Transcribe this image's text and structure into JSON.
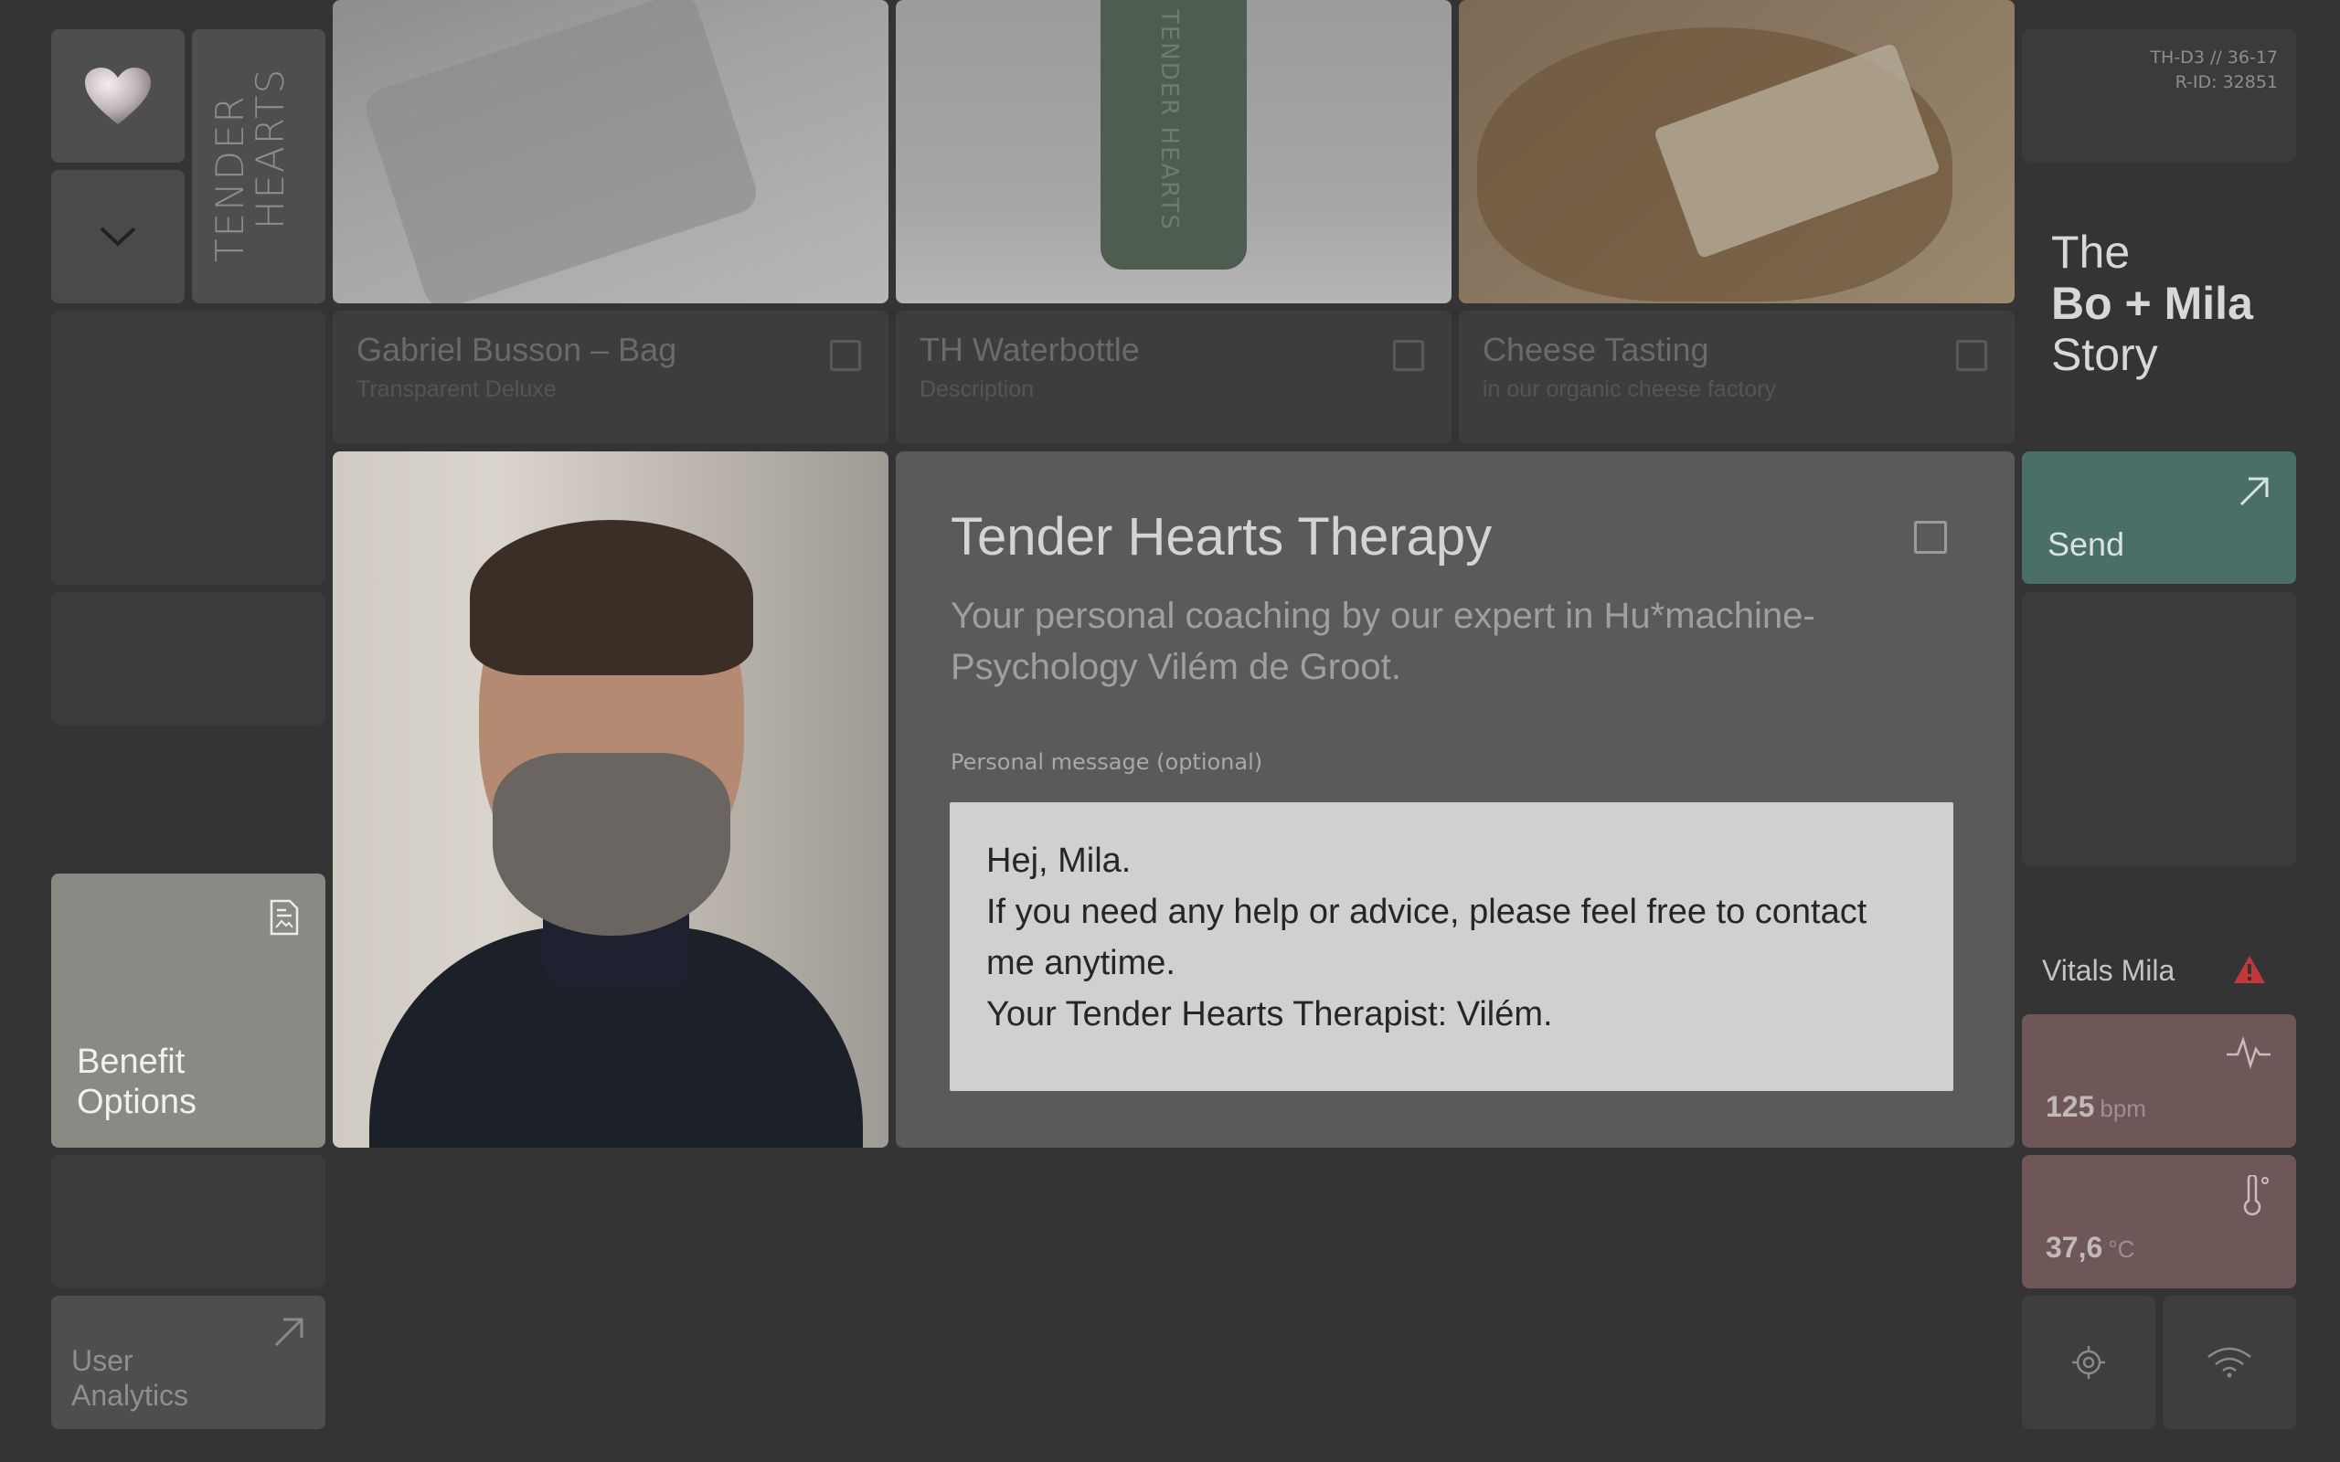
{
  "brand": {
    "logo_line1": "TENDER",
    "logo_line2": "HEARTS"
  },
  "products": [
    {
      "title": "Gabriel Busson – Bag",
      "subtitle": "Transparent Deluxe"
    },
    {
      "title": "TH Waterbottle",
      "subtitle": "Description",
      "bottle_text": "TENDER HEARTS"
    },
    {
      "title": "Cheese Tasting",
      "subtitle": "in our organic cheese factory"
    }
  ],
  "sidebar": {
    "benefit_label": "Benefit Options",
    "analytics_label": "User Analytics"
  },
  "therapy": {
    "title": "Tender Hearts Therapy",
    "description": "Your personal coaching by our expert in Hu*machine-Psychology Vilém de Groot.",
    "message_label": "Personal message (optional)",
    "message": "Hej, Mila.\nIf you need any help or advice, please feel free to contact me anytime.\nYour Tender Hearts Therapist: Vilém."
  },
  "meta": {
    "line1": "TH-D3 // 36-17",
    "line2": "R-ID: 32851"
  },
  "story": {
    "line1": "The",
    "line2": "Bo + Mila",
    "line3": "Story"
  },
  "send": {
    "label": "Send"
  },
  "vitals": {
    "title": "Vitals Mila",
    "heart_rate": {
      "value": "125",
      "unit": "bpm"
    },
    "temperature": {
      "value": "37,6",
      "unit": "°C"
    }
  },
  "colors": {
    "background": "#343434",
    "send_accent": "#4a6f69",
    "vital_accent": "#6f5758",
    "warning": "#c0383c"
  }
}
